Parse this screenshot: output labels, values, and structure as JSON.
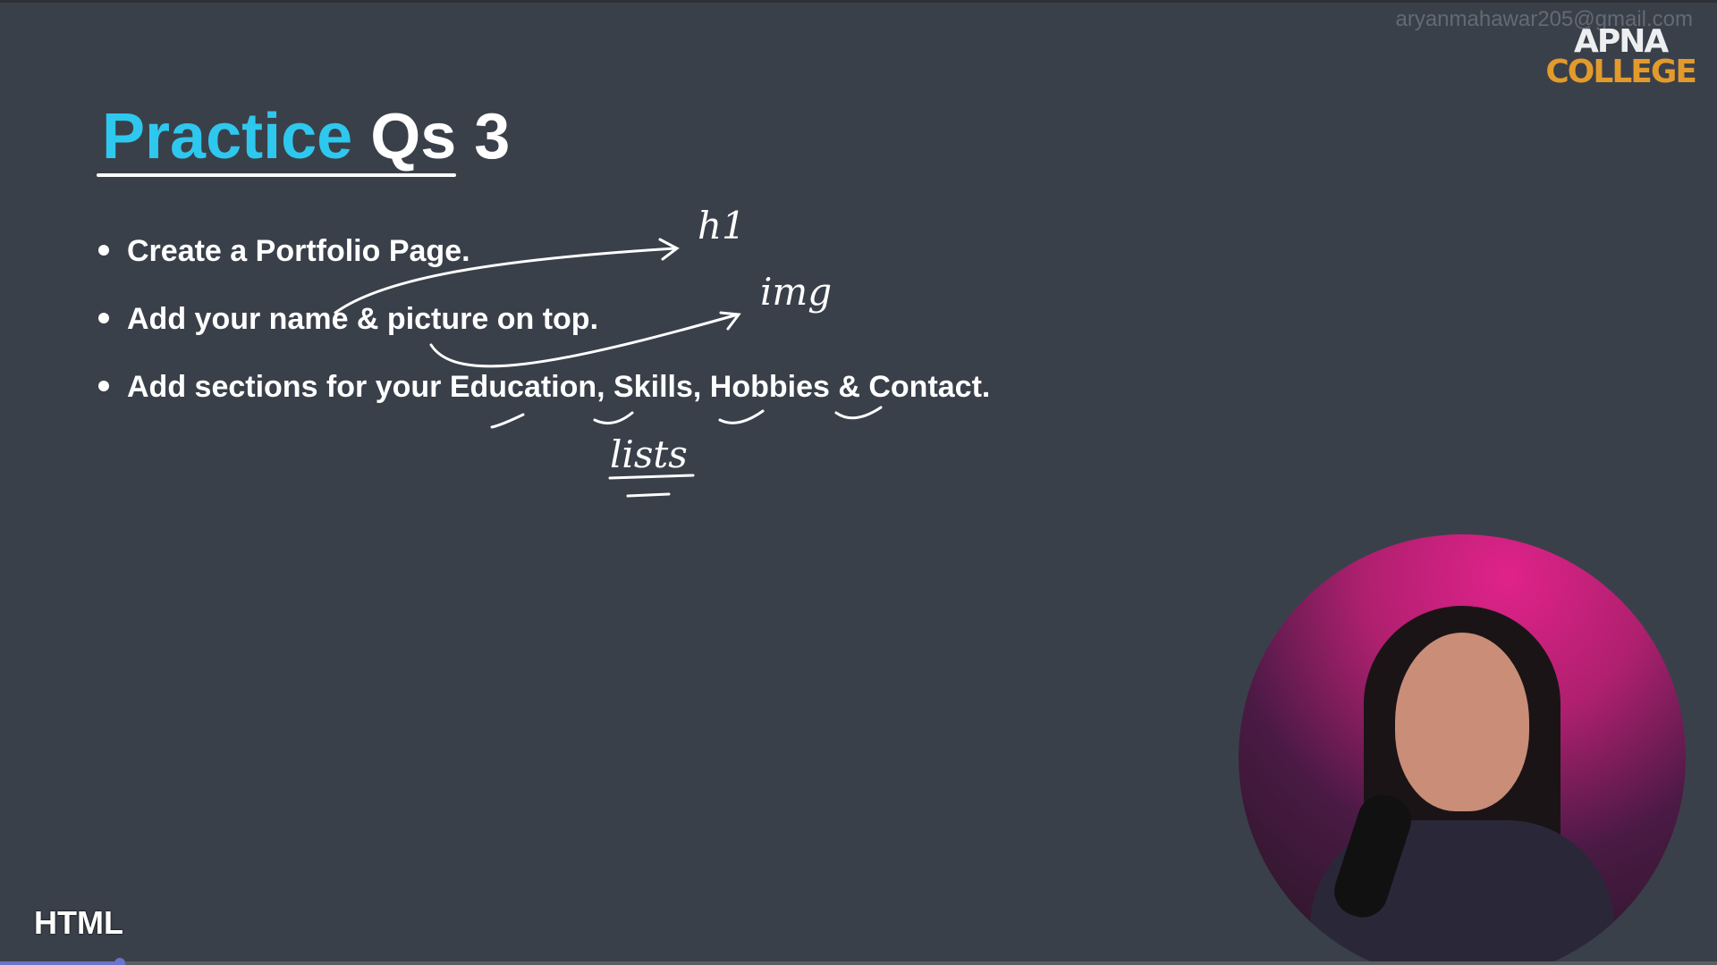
{
  "watermark_email": "aryanmahawar205@gmail.com",
  "logo": {
    "line1": "APNA",
    "line2": "COLLEGE",
    "colors": {
      "line1": "#eceef0",
      "line2": "#e39a2d"
    }
  },
  "title": {
    "highlight": "Practice",
    "rest": "Qs 3",
    "accent_color": "#2ec8ee"
  },
  "bullets": [
    "Create a Portfolio Page.",
    "Add your name & picture on top.",
    "Add sections for your Education, Skills, Hobbies & Contact."
  ],
  "annotations": {
    "h1": "h1",
    "img": "img",
    "lists": "lists"
  },
  "footer_label": "HTML",
  "video_progress_percent": 7,
  "webcam_icon": "presenter-webcam"
}
